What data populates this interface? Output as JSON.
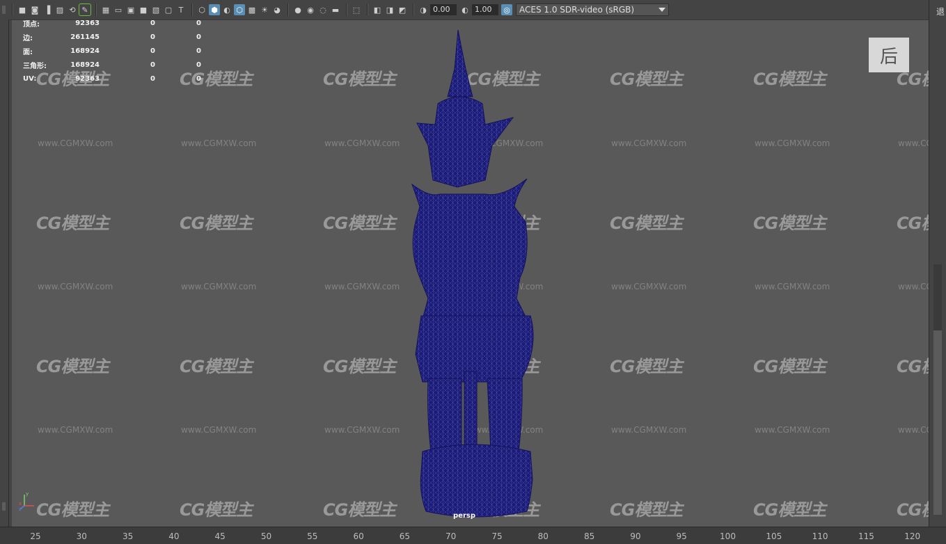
{
  "toolbar": {
    "icons": [
      "camera-icon",
      "camera-attributes-icon",
      "bookmark-icon",
      "image-plane-icon",
      "2d-pan-zoom-icon",
      "grease-pencil-icon",
      "grid-icon",
      "film-gate-icon",
      "resolution-gate-icon",
      "gate-mask-icon",
      "field-chart-icon",
      "safe-action-icon",
      "safe-title-icon",
      "wireframe-icon",
      "smooth-shade-icon",
      "use-default-material-icon",
      "wireframe-on-shaded-icon",
      "textured-icon",
      "use-all-lights-icon",
      "shadows-icon",
      "screen-space-ao-icon",
      "motion-blur-icon",
      "anti-aliasing-icon",
      "depth-of-field-icon",
      "isolate-select-icon",
      "xray-icon",
      "xray-joints-icon",
      "backface-culling-icon",
      "exposure-icon",
      "gamma-icon",
      "color-management-icon"
    ],
    "exposure_value": "0.00",
    "gamma_value": "1.00",
    "colorspace_label": "ACES 1.0 SDR-video (sRGB)"
  },
  "hud": {
    "rows": [
      {
        "label": "顶点:",
        "v1": "92363",
        "v2": "0",
        "v3": "0"
      },
      {
        "label": "边:",
        "v1": "261145",
        "v2": "0",
        "v3": "0"
      },
      {
        "label": "面:",
        "v1": "168924",
        "v2": "0",
        "v3": "0"
      },
      {
        "label": "三角形:",
        "v1": "168924",
        "v2": "0",
        "v3": "0"
      },
      {
        "label": "UV:",
        "v1": "92363",
        "v2": "0",
        "v3": "0"
      }
    ]
  },
  "watermark": {
    "logo": "CG模型主",
    "url": "www.CGMXW.com"
  },
  "viewport": {
    "camera_label": "persp",
    "corner_badge": "后",
    "mesh_color": "#1a1a7a"
  },
  "axis": {
    "x": "x",
    "y": "y",
    "z": "z"
  },
  "right_panel": {
    "text": "退"
  },
  "timeline": {
    "ticks": [
      "25",
      "30",
      "35",
      "40",
      "45",
      "50",
      "55",
      "60",
      "65",
      "70",
      "75",
      "80",
      "85",
      "90",
      "95",
      "100",
      "105",
      "110",
      "115",
      "120"
    ]
  }
}
